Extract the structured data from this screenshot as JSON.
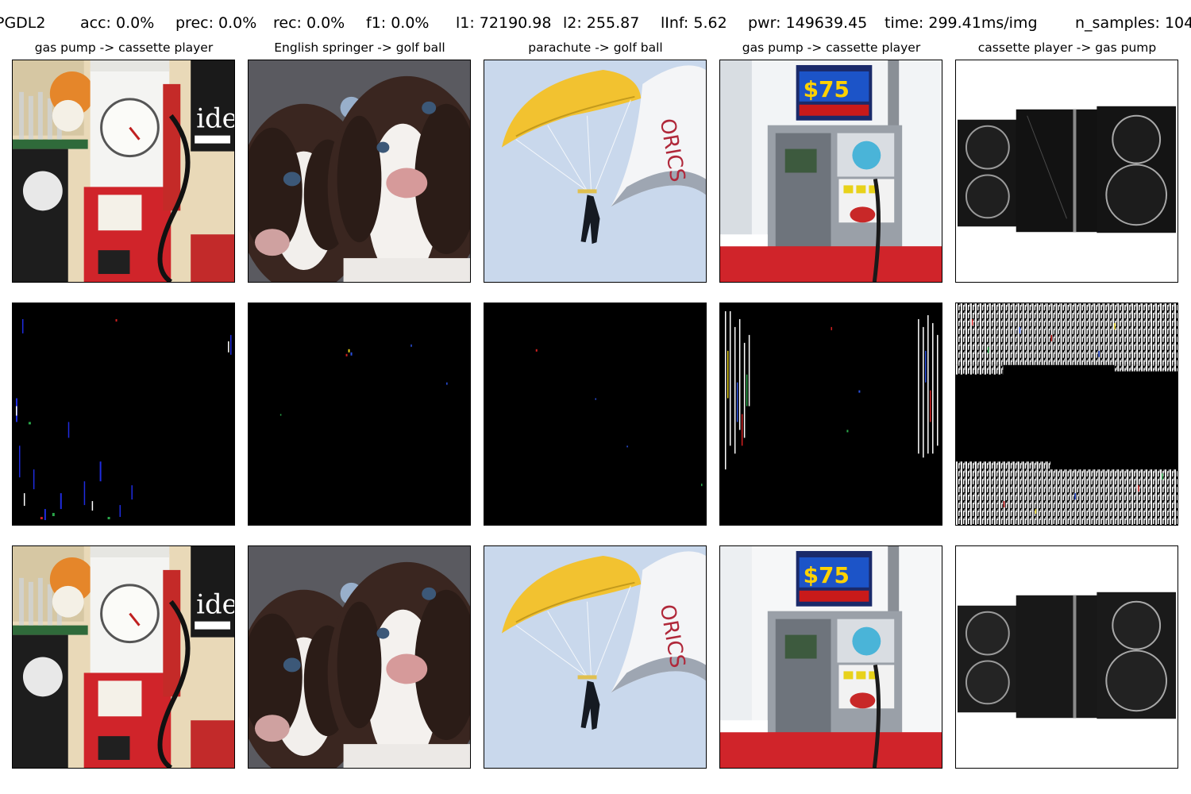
{
  "header": {
    "stats": [
      {
        "key": "method",
        "text": "PGDL2"
      },
      {
        "key": "acc",
        "text": "acc: 0.0%"
      },
      {
        "key": "prec",
        "text": "prec: 0.0%"
      },
      {
        "key": "rec",
        "text": "rec: 0.0%"
      },
      {
        "key": "f1",
        "text": "f1: 0.0%"
      },
      {
        "key": "l1",
        "text": "l1: 72190.98"
      },
      {
        "key": "l2",
        "text": "l2: 255.87"
      },
      {
        "key": "linf",
        "text": "lInf: 5.62"
      },
      {
        "key": "pwr",
        "text": "pwr: 149639.45"
      },
      {
        "key": "time",
        "text": "time: 299.41ms/img"
      },
      {
        "key": "n_samples",
        "text": "n_samples: 104"
      }
    ]
  },
  "columns": [
    {
      "title": "gas pump -> cassette player",
      "image": "gas-pump-vintage"
    },
    {
      "title": "English springer -> golf ball",
      "image": "springer-puppies"
    },
    {
      "title": "parachute -> golf ball",
      "image": "parachute"
    },
    {
      "title": "gas pump -> cassette player",
      "image": "gas-pump-modern"
    },
    {
      "title": "cassette player -> gas pump",
      "image": "stereo-speakers"
    }
  ],
  "rows": [
    "original",
    "perturbation",
    "adversarial"
  ],
  "colors": {
    "panel_border": "#000000",
    "perturbation_bg": "#000000",
    "pump_red": "#d0242a",
    "sky": "#c9d8ec",
    "canopy": "#f2c230",
    "dog_brown": "#3a2620",
    "speaker_black": "#161616"
  }
}
